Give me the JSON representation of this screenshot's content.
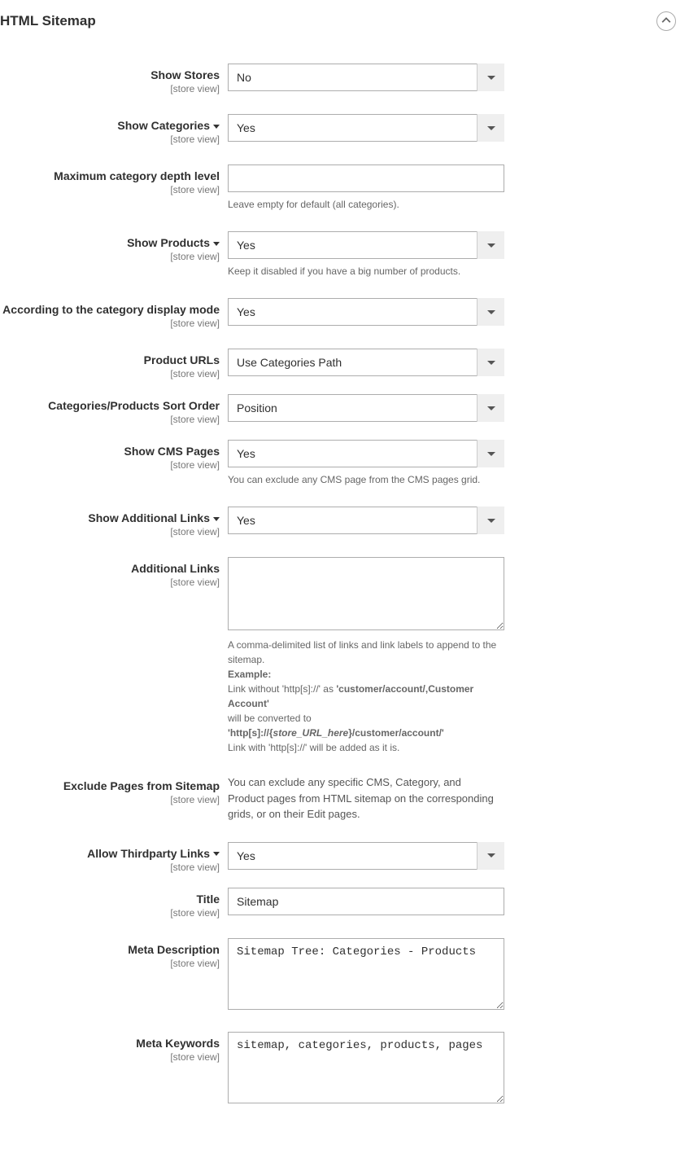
{
  "section": {
    "title": "HTML Sitemap"
  },
  "scope_label": "[store view]",
  "fields": {
    "show_stores": {
      "label": "Show Stores",
      "value": "No"
    },
    "show_categories": {
      "label": "Show Categories",
      "value": "Yes"
    },
    "max_category_depth": {
      "label": "Maximum category depth level",
      "value": "",
      "note": "Leave empty for default (all categories)."
    },
    "show_products": {
      "label": "Show Products",
      "value": "Yes",
      "note": "Keep it disabled if you have a big number of products."
    },
    "category_display_mode": {
      "label": "According to the category display mode",
      "value": "Yes"
    },
    "product_urls": {
      "label": "Product URLs",
      "value": "Use Categories Path"
    },
    "sort_order": {
      "label": "Categories/Products Sort Order",
      "value": "Position"
    },
    "show_cms": {
      "label": "Show CMS Pages",
      "value": "Yes",
      "note": "You can exclude any CMS page from the CMS pages grid."
    },
    "show_additional": {
      "label": "Show Additional Links",
      "value": "Yes"
    },
    "additional_links": {
      "label": "Additional Links",
      "value": "",
      "note_pre": "A comma-delimited list of links and link labels to append to the sitemap.",
      "note_example_label": "Example:",
      "note_l1a": "Link without 'http[s]://' as ",
      "note_l1b": "'customer/account/,Customer Account'",
      "note_l2": "will be converted to",
      "note_l3a": "'http[s]://{",
      "note_l3b": "store_URL_here",
      "note_l3c": "}/customer/account/'",
      "note_l4": "Link with 'http[s]://' will be added as it is."
    },
    "exclude_pages": {
      "label": "Exclude Pages from Sitemap",
      "note": "You can exclude any specific CMS, Category, and Product pages from HTML sitemap on the corresponding grids, or on their Edit pages."
    },
    "allow_thirdparty": {
      "label": "Allow Thirdparty Links",
      "value": "Yes"
    },
    "title": {
      "label": "Title",
      "value": "Sitemap"
    },
    "meta_description": {
      "label": "Meta Description",
      "value": "Sitemap Tree: Categories - Products"
    },
    "meta_keywords": {
      "label": "Meta Keywords",
      "value": "sitemap, categories, products, pages"
    }
  }
}
